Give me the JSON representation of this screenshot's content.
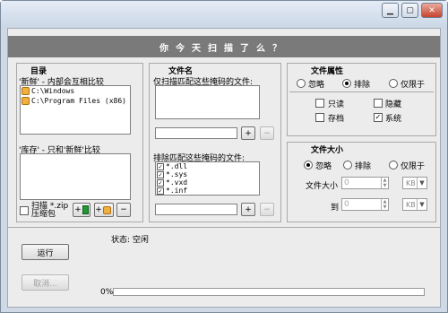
{
  "banner": "你今天扫描了么？",
  "directories": {
    "title": "目录",
    "new_label": "'新鲜' - 内部会互相比较",
    "new_items": [
      "C:\\Windows",
      "C:\\Program Files (x86)"
    ],
    "repo_label": "'库存' - 只和'新鲜'比较",
    "scan_zip_label": "扫描 *.zip 压缩包"
  },
  "filenames": {
    "title": "文件名",
    "include_label": "仅扫描匹配这些掩码的文件:",
    "exclude_label": "排除匹配这些掩码的文件:",
    "exclude_items": [
      "*.dll",
      "*.sys",
      "*.vxd",
      "*.inf"
    ],
    "add": "+",
    "remove": "−"
  },
  "attributes": {
    "title": "文件属性",
    "ignore": "忽略",
    "exclude": "排除",
    "only": "仅限于",
    "readonly": "只读",
    "hidden": "隐藏",
    "archive": "存档",
    "system": "系统",
    "selected_mode": "exclude",
    "system_checked": true
  },
  "filesize": {
    "title": "文件大小",
    "ignore": "忽略",
    "exclude": "排除",
    "only": "仅限于",
    "selected_mode": "ignore",
    "from_label": "文件大小",
    "to_label": "到",
    "from_value": "0",
    "to_value": "0",
    "unit_from": "KB",
    "unit_to": "KB"
  },
  "actions": {
    "run": "运行",
    "cancel": "取消..."
  },
  "status": {
    "text": "状态: 空闲",
    "progress_label": "0%",
    "progress_value": 0
  }
}
